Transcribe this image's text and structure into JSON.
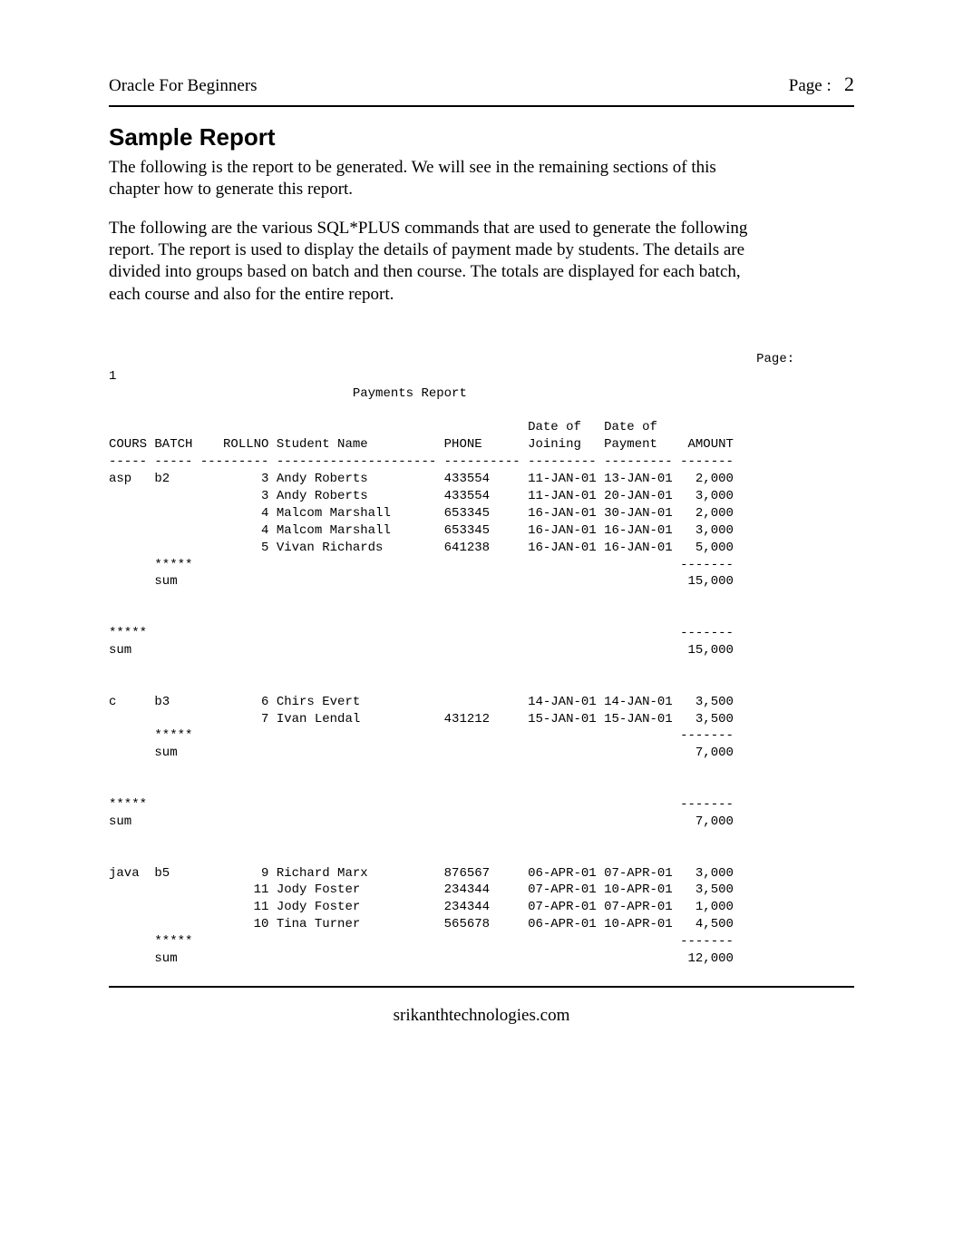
{
  "header": {
    "book_title": "Oracle For Beginners",
    "page_label": "Page :",
    "page_number": "2"
  },
  "section_heading": "Sample Report",
  "intro_para_1": "The following is the report to be generated. We will see in the remaining sections of this chapter how to generate this report.",
  "intro_para_2": "The following are the various SQL*PLUS commands that are used to generate the following report. The report is used to display the details of payment made by students. The details are divided into groups based on batch and then course. The totals are displayed for each batch, each course and also for the entire report.",
  "report": {
    "page_indicator": "Page:",
    "page_value": "1",
    "title": "Payments Report",
    "columns": {
      "cours": "COURS",
      "batch": "BATCH",
      "rollno": "ROLLNO",
      "student_name": "Student Name",
      "phone": "PHONE",
      "date_joining_label1": "Date of",
      "date_joining_label2": "Joining",
      "date_payment_label1": "Date of",
      "date_payment_label2": "Payment",
      "amount": "AMOUNT"
    },
    "groups": [
      {
        "course": "asp",
        "batch": "b2",
        "rows": [
          {
            "rollno": "3",
            "name": "Andy Roberts",
            "phone": "433554",
            "joining": "11-JAN-01",
            "payment": "13-JAN-01",
            "amount": "2,000"
          },
          {
            "rollno": "3",
            "name": "Andy Roberts",
            "phone": "433554",
            "joining": "11-JAN-01",
            "payment": "20-JAN-01",
            "amount": "3,000"
          },
          {
            "rollno": "4",
            "name": "Malcom Marshall",
            "phone": "653345",
            "joining": "16-JAN-01",
            "payment": "30-JAN-01",
            "amount": "2,000"
          },
          {
            "rollno": "4",
            "name": "Malcom Marshall",
            "phone": "653345",
            "joining": "16-JAN-01",
            "payment": "16-JAN-01",
            "amount": "3,000"
          },
          {
            "rollno": "5",
            "name": "Vivan Richards",
            "phone": "641238",
            "joining": "16-JAN-01",
            "payment": "16-JAN-01",
            "amount": "5,000"
          }
        ],
        "batch_sum": "15,000",
        "course_sum": "15,000"
      },
      {
        "course": "c",
        "batch": "b3",
        "rows": [
          {
            "rollno": "6",
            "name": "Chirs Evert",
            "phone": "",
            "joining": "14-JAN-01",
            "payment": "14-JAN-01",
            "amount": "3,500"
          },
          {
            "rollno": "7",
            "name": "Ivan Lendal",
            "phone": "431212",
            "joining": "15-JAN-01",
            "payment": "15-JAN-01",
            "amount": "3,500"
          }
        ],
        "batch_sum": "7,000",
        "course_sum": "7,000"
      },
      {
        "course": "java",
        "batch": "b5",
        "rows": [
          {
            "rollno": "9",
            "name": "Richard Marx",
            "phone": "876567",
            "joining": "06-APR-01",
            "payment": "07-APR-01",
            "amount": "3,000"
          },
          {
            "rollno": "11",
            "name": "Jody Foster",
            "phone": "234344",
            "joining": "07-APR-01",
            "payment": "10-APR-01",
            "amount": "3,500"
          },
          {
            "rollno": "11",
            "name": "Jody Foster",
            "phone": "234344",
            "joining": "07-APR-01",
            "payment": "07-APR-01",
            "amount": "1,000"
          },
          {
            "rollno": "10",
            "name": "Tina Turner",
            "phone": "565678",
            "joining": "06-APR-01",
            "payment": "10-APR-01",
            "amount": "4,500"
          }
        ],
        "batch_sum": "12,000"
      }
    ],
    "star_marker": "*****",
    "sum_label": "sum",
    "dash7": "-------"
  },
  "footer": "srikanthtechnologies.com"
}
